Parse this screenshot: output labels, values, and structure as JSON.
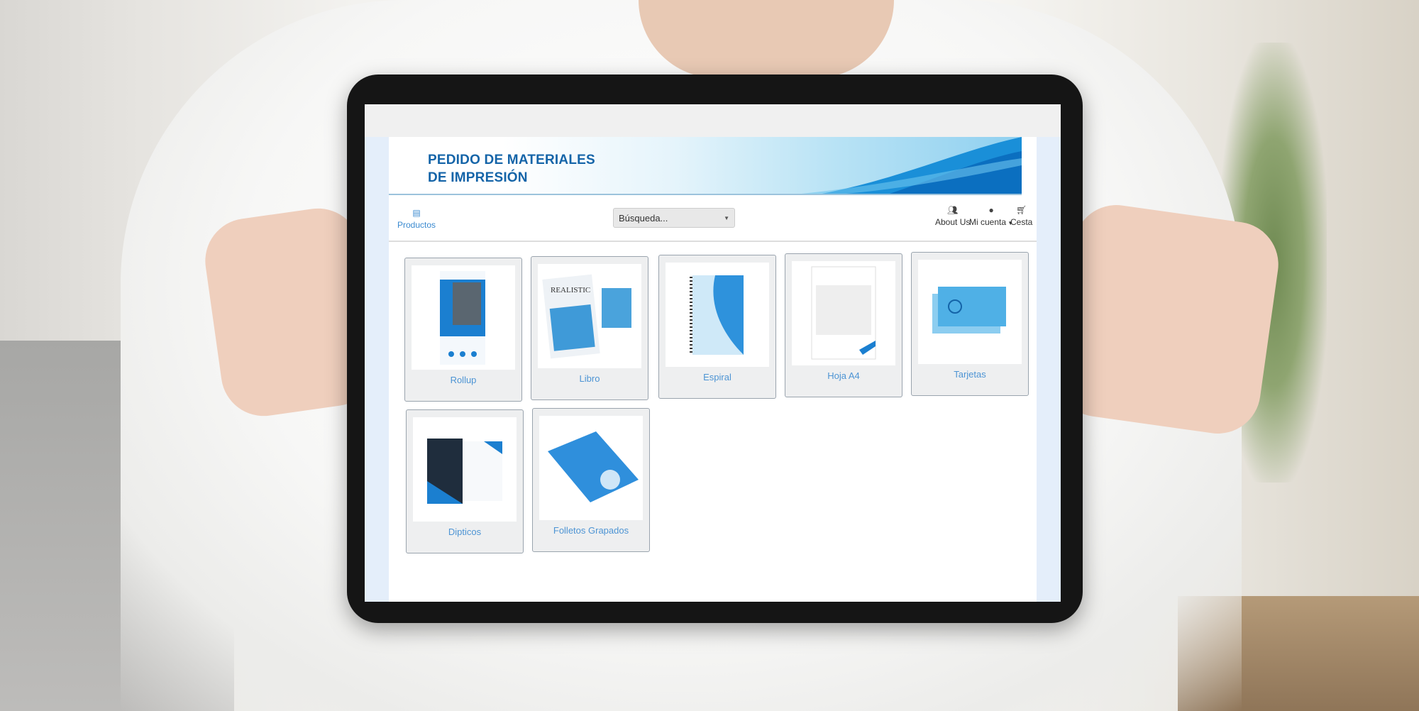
{
  "header": {
    "title_line1": "PEDIDO DE MATERIALES",
    "title_line2": "DE IMPRESIÓN"
  },
  "nav": {
    "products": {
      "label": "Productos",
      "icon": "archive-icon"
    },
    "search": {
      "placeholder": "Búsqueda..."
    },
    "about": {
      "label": "About Us",
      "icon": "users-icon"
    },
    "account": {
      "label": "Mi cuenta",
      "icon": "user-circle-icon"
    },
    "cart": {
      "label": "Cesta",
      "icon": "shopping-cart-icon"
    }
  },
  "products": [
    {
      "label": "Rollup"
    },
    {
      "label": "Libro"
    },
    {
      "label": "Espiral"
    },
    {
      "label": "Hoja A4"
    },
    {
      "label": "Tarjetas"
    },
    {
      "label": "Dipticos"
    },
    {
      "label": "Folletos Grapados"
    }
  ],
  "colors": {
    "brand": "#1464a8",
    "link": "#4d94d4",
    "accent": "#3a8ad0"
  }
}
